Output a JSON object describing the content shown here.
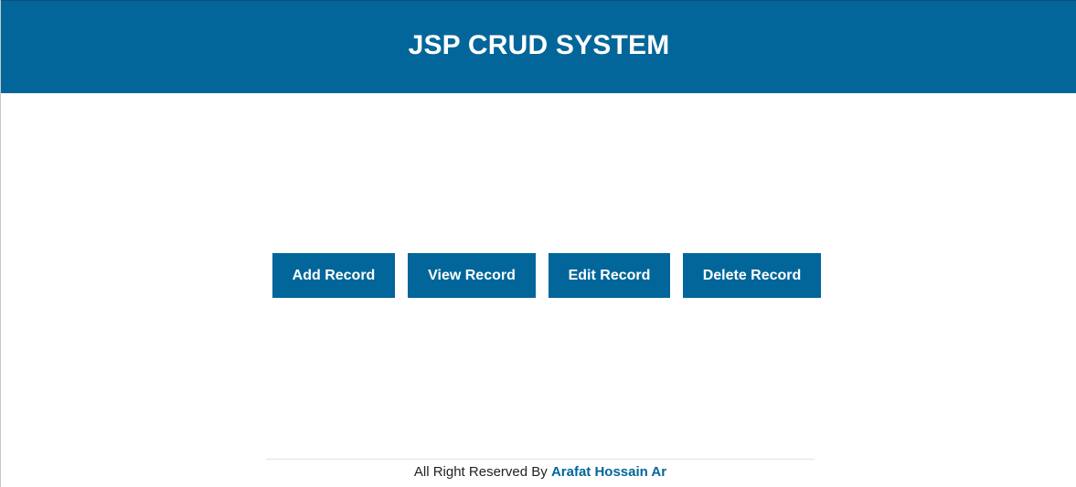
{
  "header": {
    "title": "JSP CRUD SYSTEM"
  },
  "nav": {
    "buttons": [
      {
        "label": "Add Record"
      },
      {
        "label": "View Record"
      },
      {
        "label": "Edit Record"
      },
      {
        "label": "Delete Record"
      }
    ]
  },
  "footer": {
    "text": "All Right Reserved By",
    "author_link": "Arafat Hossain Ar"
  },
  "colors": {
    "primary": "#02669a",
    "background": "#ffffff",
    "text": "#222222"
  }
}
